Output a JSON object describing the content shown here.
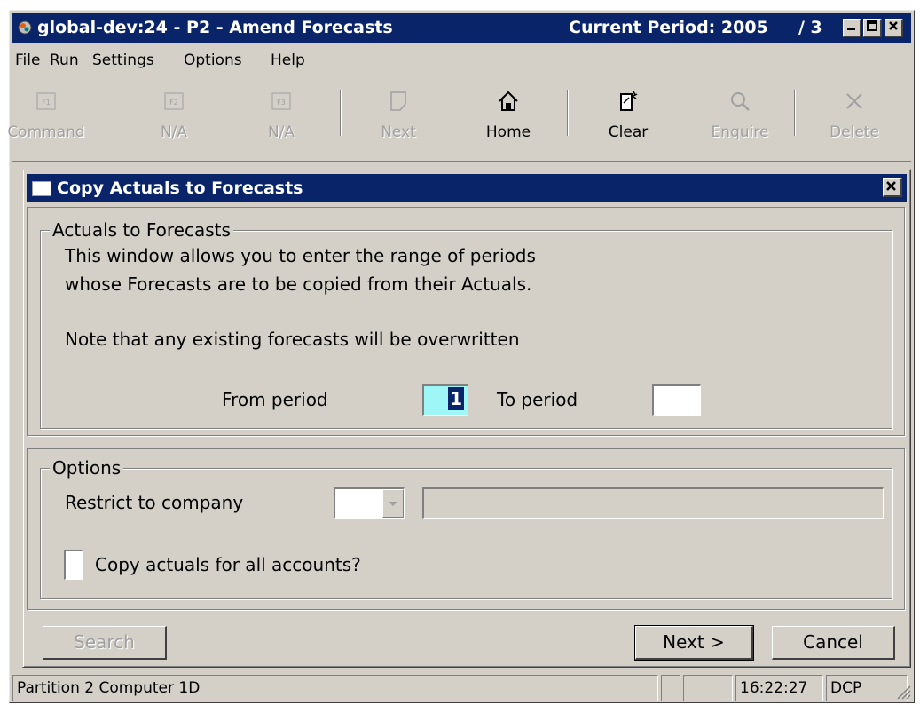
{
  "window": {
    "title": "global-dev:24 - P2 - Amend Forecasts",
    "current_period": "Current Period: 2005",
    "period_suffix": "/ 3"
  },
  "menu": [
    {
      "name": "menu-file",
      "label": "File"
    },
    {
      "name": "menu-run",
      "label": "Run"
    },
    {
      "name": "menu-settings",
      "label": "Settings"
    },
    {
      "name": "menu-options",
      "label": "Options"
    },
    {
      "name": "menu-help",
      "label": "Help"
    }
  ],
  "toolbar": {
    "command": "Command",
    "f2": "N/A",
    "f3": "N/A",
    "next": "Next",
    "home": "Home",
    "clear": "Clear",
    "enquire": "Enquire",
    "delete": "Delete",
    "f1_key": "F1",
    "f2_key": "F2",
    "f3_key": "F3"
  },
  "dialog": {
    "title": "Copy Actuals to Forecasts",
    "group1_title": "Actuals to Forecasts",
    "desc_line1": "This window allows you to enter the range of periods",
    "desc_line2": "whose Forecasts are to be copied from their Actuals.",
    "note": "Note that any existing forecasts will be overwritten",
    "from_label": "From period",
    "from_value": "1",
    "to_label": "To period",
    "to_value": "",
    "group2_title": "Options",
    "restrict_label": "Restrict to company",
    "company_value": "",
    "company_name": "",
    "checkbox_label": "Copy actuals for all accounts?",
    "search_button": "Search",
    "next_button": "Next >",
    "cancel_button": "Cancel"
  },
  "statusbar": {
    "message": "Partition 2 Computer 1D",
    "time": "16:22:27",
    "user": "DCP"
  },
  "colors": {
    "titlebar": "#0a246a",
    "face": "#d4d0c8",
    "active_field": "#9ff6f6"
  }
}
